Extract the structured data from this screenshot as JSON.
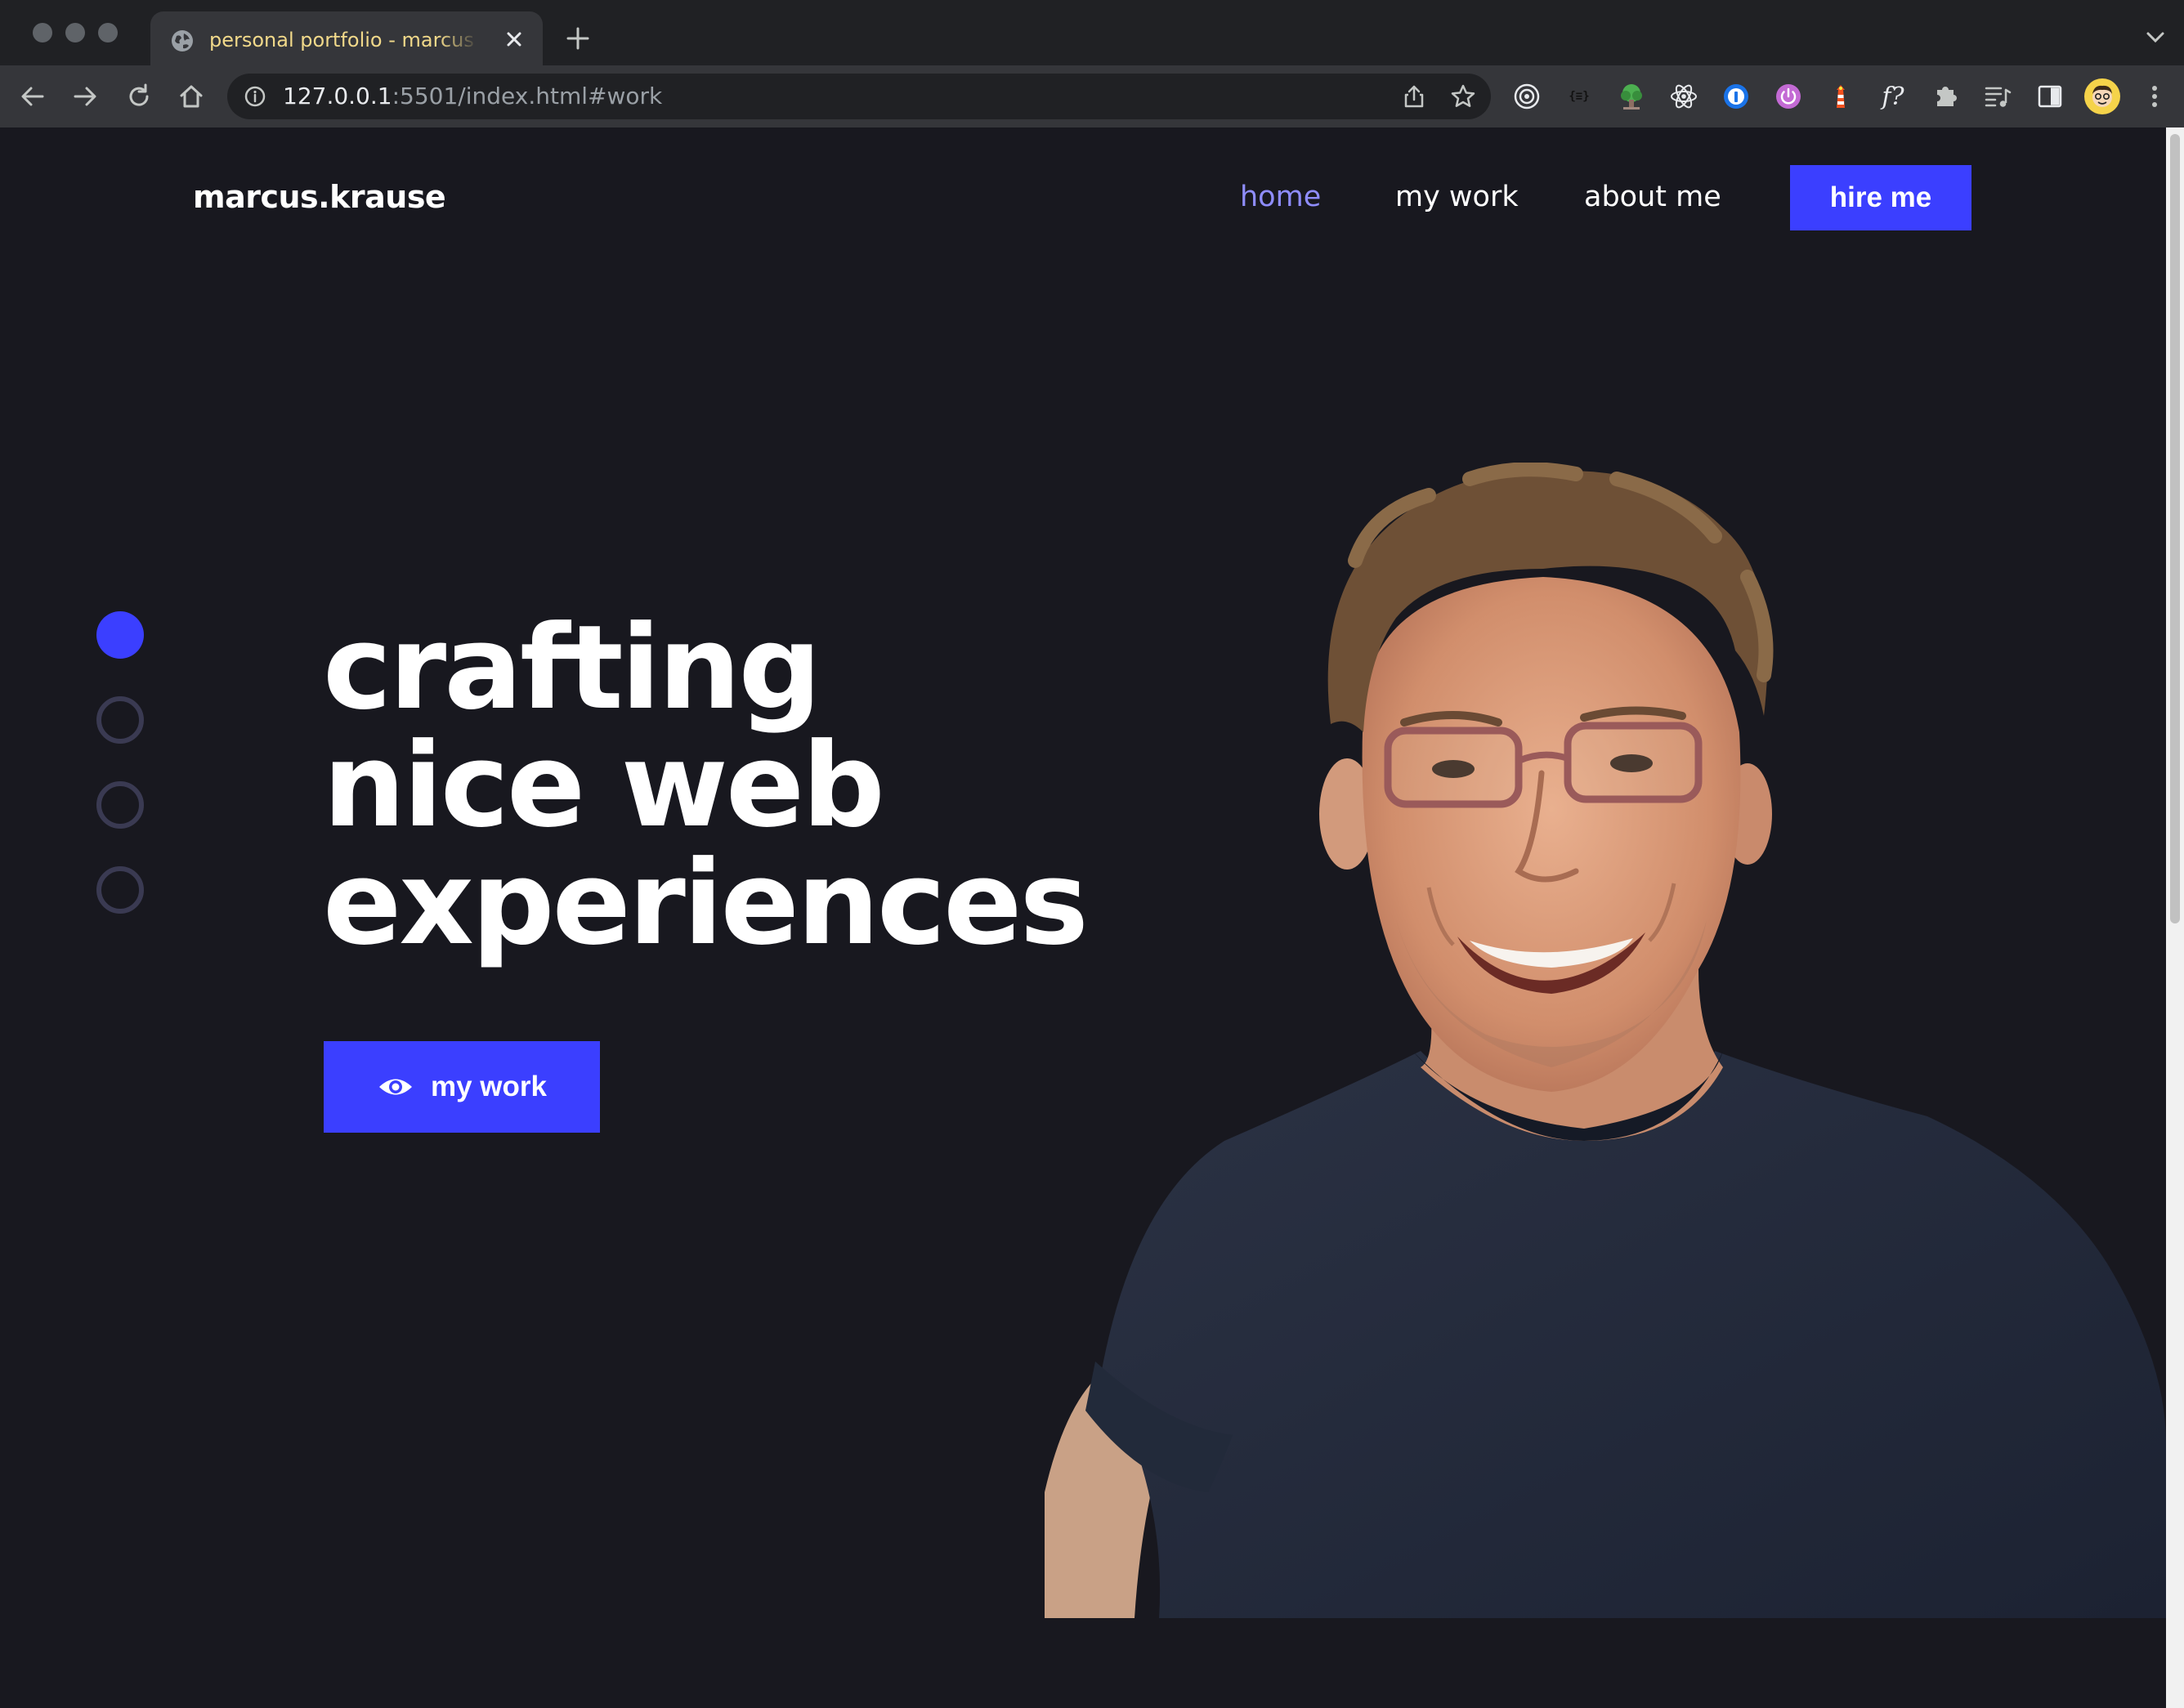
{
  "browser": {
    "tab_title": "personal portfolio - marcus krause",
    "url_host": "127.0.0.1",
    "url_rest": ":5501/index.html#work",
    "extensions": [
      "target-icon",
      "json-icon",
      "tree-icon",
      "react-icon",
      "info-icon",
      "power-icon",
      "lighthouse-icon",
      "function-icon",
      "puzzle-icon",
      "media-icon",
      "sidepanel-icon",
      "avatar-icon"
    ],
    "ext_json_label": "{≡}",
    "ext_fn_label": "f?"
  },
  "site": {
    "logo": "marcus.krause",
    "nav": [
      "home",
      "my work",
      "about me"
    ],
    "active_nav": "home",
    "hire_label": "hire me"
  },
  "hero": {
    "headline": [
      "crafting",
      "nice web",
      "experiences"
    ],
    "cta_label": "my work",
    "slide_dots": 4,
    "active_dot": 1
  },
  "colors": {
    "background": "#18181f",
    "accent": "#3b3fff",
    "active_link": "#8f8dff",
    "tab_title": "#f1d98a"
  }
}
